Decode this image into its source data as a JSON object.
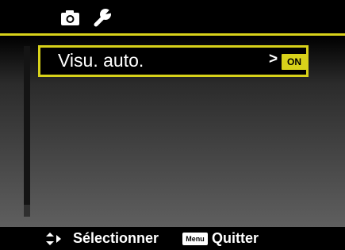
{
  "tabs": [
    {
      "icon": "camera-icon",
      "active": true
    },
    {
      "icon": "wrench-icon",
      "active": false
    }
  ],
  "menu": {
    "items": [
      {
        "label": "Visu. auto.",
        "arrow": ">",
        "value": "ON",
        "selected": true
      }
    ]
  },
  "footer": {
    "nav_icon": "up-down-right-arrows-icon",
    "select_label": "Sélectionner",
    "menu_key": "Menu",
    "quit_label": "Quitter"
  },
  "colors": {
    "accent": "#d8d21a",
    "background": "#000000",
    "text": "#ffffff"
  }
}
